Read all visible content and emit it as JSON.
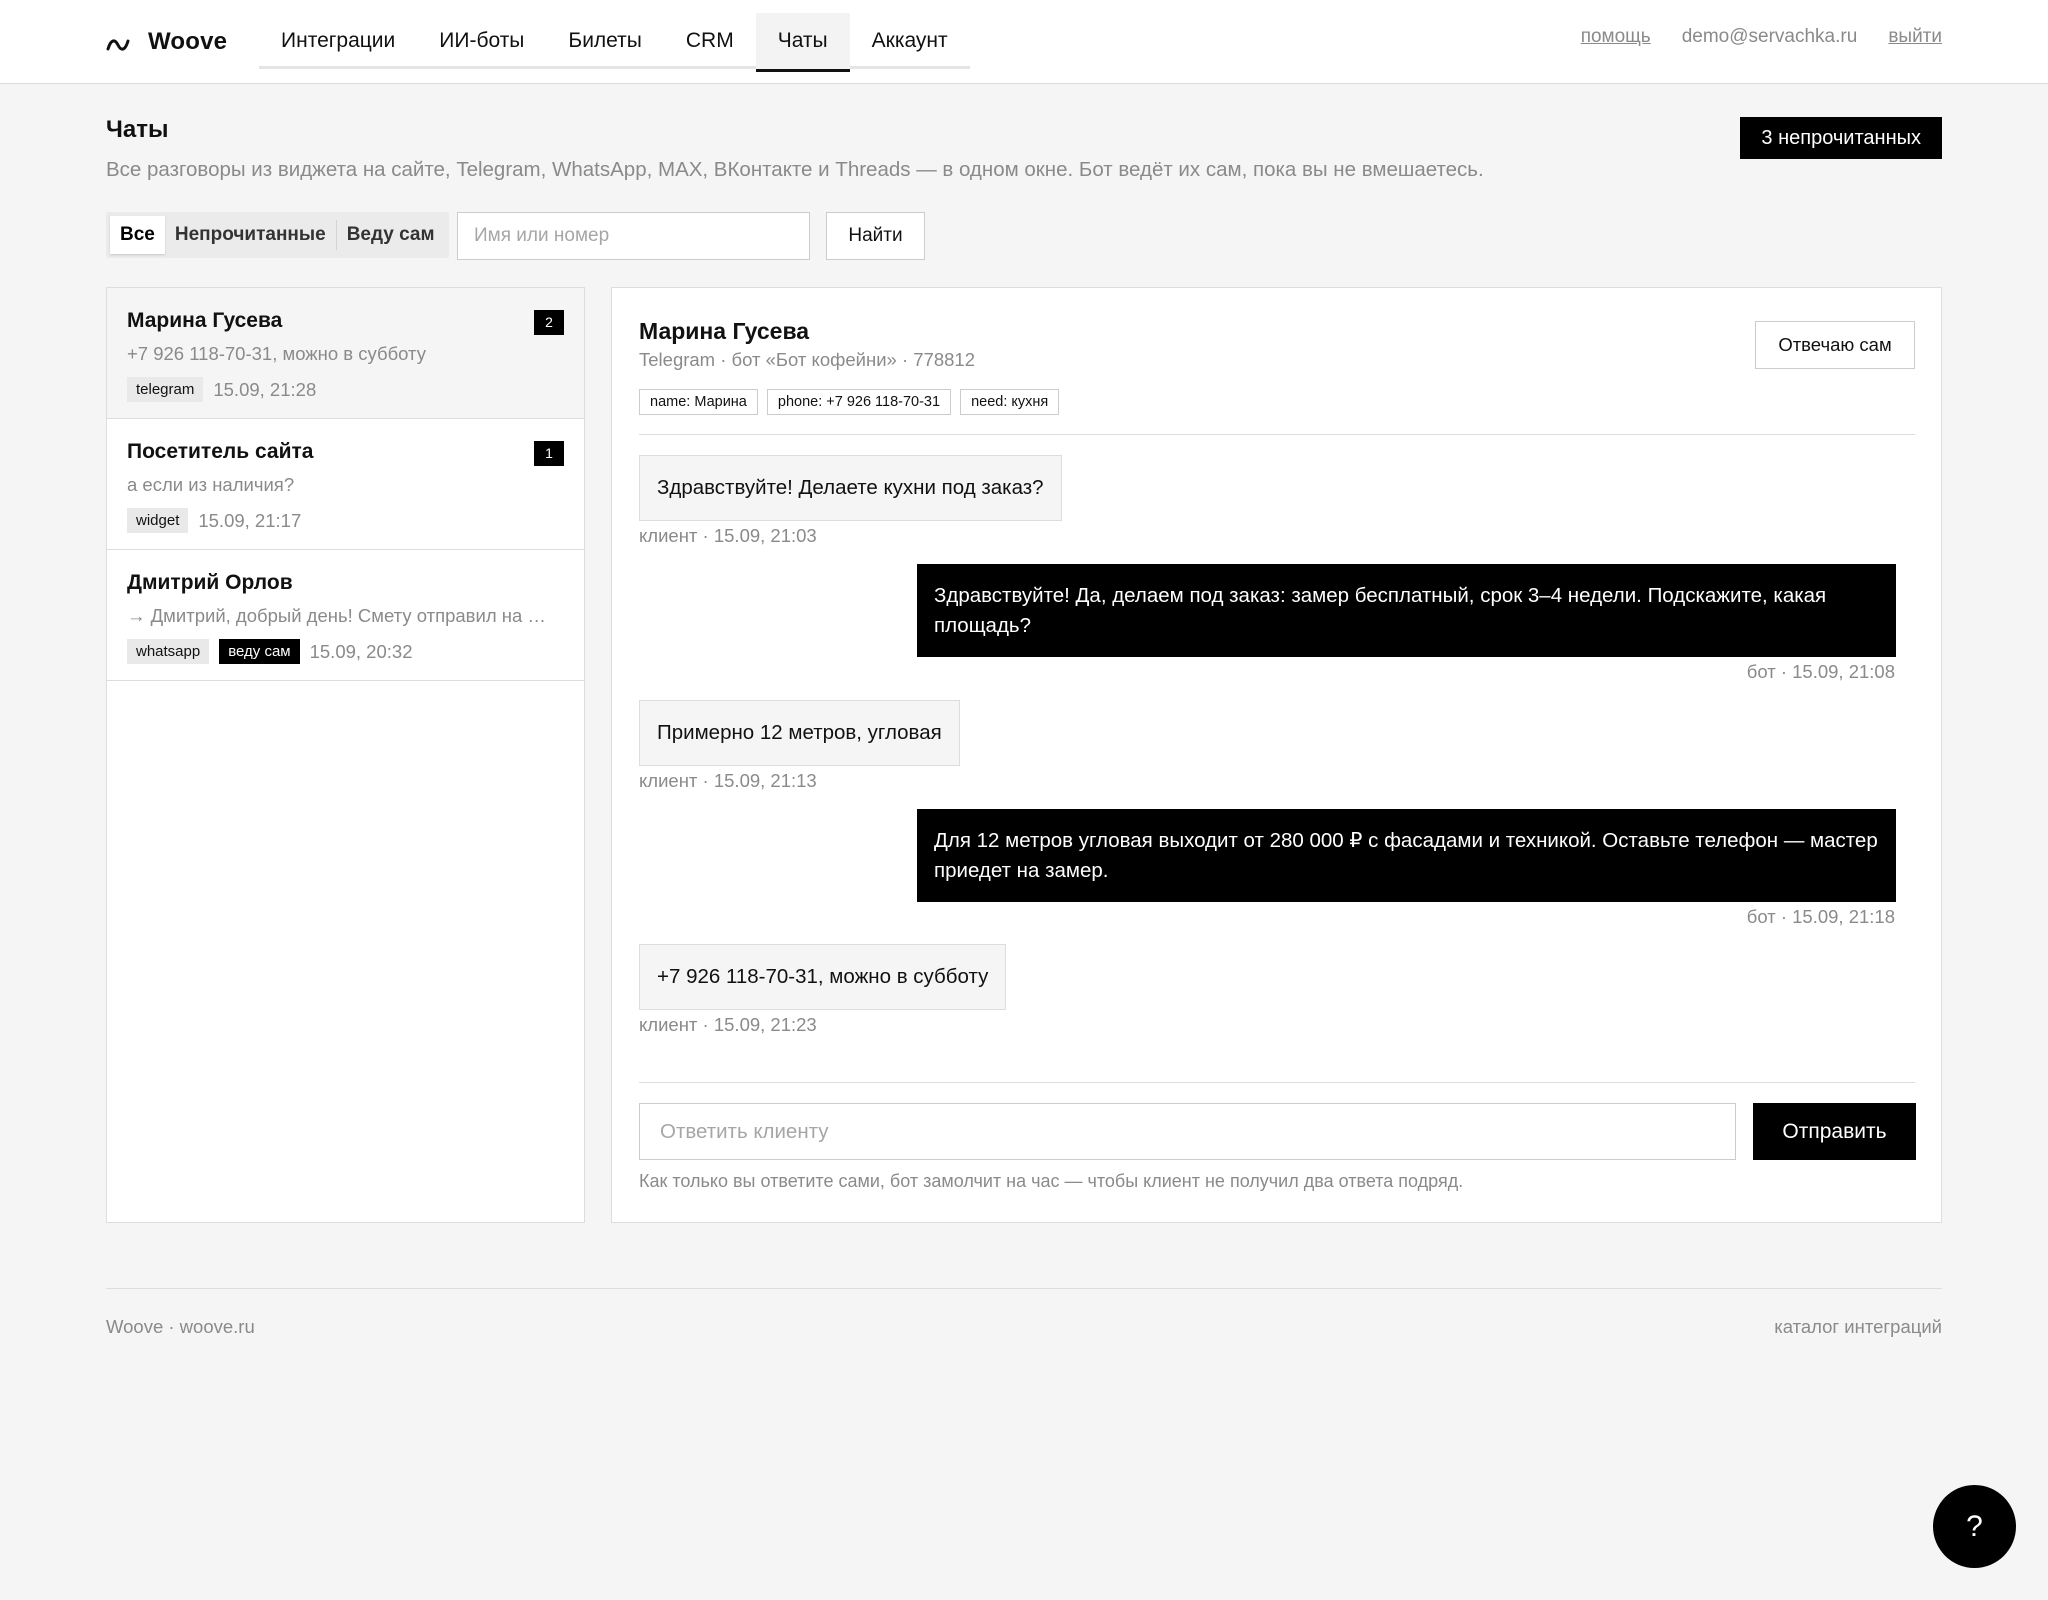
{
  "brand": {
    "name": "Woove",
    "icon": "wave-logo-icon"
  },
  "nav": {
    "tabs": [
      {
        "label": "Интеграции",
        "active": false
      },
      {
        "label": "ИИ-боты",
        "active": false
      },
      {
        "label": "Билеты",
        "active": false
      },
      {
        "label": "CRM",
        "active": false
      },
      {
        "label": "Чаты",
        "active": true
      },
      {
        "label": "Аккаунт",
        "active": false
      }
    ]
  },
  "top_right": {
    "help": "помощь",
    "email": "demo@servachka.ru",
    "logout": "выйти"
  },
  "header": {
    "title": "Чаты",
    "subtitle": "Все разговоры из виджета на сайте, Telegram, WhatsApp, MAX, ВКонтакте и Threads — в одном окне. Бот ведёт их сам, пока вы не вмешаетесь.",
    "unread_button": "3 непрочитанных"
  },
  "filters": {
    "segments": [
      {
        "label": "Все",
        "active": true
      },
      {
        "label": "Непрочитанные",
        "active": false
      },
      {
        "label": "Веду сам",
        "active": false
      }
    ],
    "search_placeholder": "Имя или номер",
    "search_value": "",
    "search_button": "Найти"
  },
  "chats": [
    {
      "name": "Марина Гусева",
      "preview": "+7 926 118-70-31, можно в субботу",
      "channel": "telegram",
      "extra_tag": "",
      "time": "15.09, 21:28",
      "unread": "2",
      "selected": true
    },
    {
      "name": "Посетитель сайта",
      "preview": "а если из наличия?",
      "channel": "widget",
      "extra_tag": "",
      "time": "15.09, 21:17",
      "unread": "1",
      "selected": false
    },
    {
      "name": "Дмитрий Орлов",
      "preview": "→ Дмитрий, добрый день! Смету отправил на почту, проверьте, пожалуйста",
      "channel": "whatsapp",
      "extra_tag": "веду сам",
      "time": "15.09, 20:32",
      "unread": "",
      "selected": false
    }
  ],
  "conversation": {
    "name": "Марина Гусева",
    "subtitle": "Telegram · бот «Бот кофейни» · 778812",
    "vars": [
      "name: Марина",
      "phone: +7 926 118-70-31",
      "need: кухня"
    ],
    "takeover_button": "Отвечаю сам",
    "messages": [
      {
        "from": "client",
        "text": "Здравствуйте! Делаете кухни под заказ?",
        "meta": "клиент · 15.09, 21:03"
      },
      {
        "from": "bot",
        "text": "Здравствуйте! Да, делаем под заказ: замер бесплатный, срок 3–4 недели. Подскажите, какая площадь?",
        "meta": "бот · 15.09, 21:08"
      },
      {
        "from": "client",
        "text": "Примерно 12 метров, угловая",
        "meta": "клиент · 15.09, 21:13"
      },
      {
        "from": "bot",
        "text": "Для 12 метров угловая выходит от 280 000 ₽ с фасадами и техникой. Оставьте телефон — мастер приедет на замер.",
        "meta": "бот · 15.09, 21:18"
      },
      {
        "from": "client",
        "text": "+7 926 118-70-31, можно в субботу",
        "meta": "клиент · 15.09, 21:23"
      }
    ],
    "reply_placeholder": "Ответить клиенту",
    "reply_value": "",
    "send_button": "Отправить",
    "hint": "Как только вы ответите сами, бот замолчит на час — чтобы клиент не получил два ответа подряд."
  },
  "footer": {
    "left": "Woove · woove.ru",
    "right": "каталог интеграций"
  },
  "help_fab": {
    "label": "?"
  },
  "colors": {
    "accent": "#000000",
    "muted": "#8a8a8a",
    "background": "#f5f5f5"
  }
}
